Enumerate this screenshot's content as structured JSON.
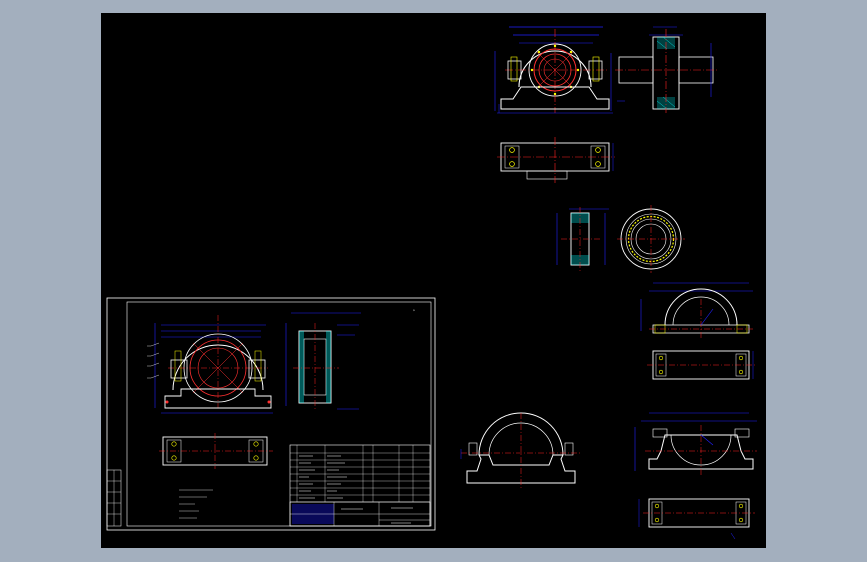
{
  "app": {
    "window_title": "",
    "background_color": "#a3afbe"
  },
  "viewport": {
    "background": "#000000"
  },
  "colors": {
    "outline": "#ffffff",
    "dimension": "#2222ff",
    "centerline": "#ff2222",
    "bearing": "#ff3030",
    "hatch": "#00ffff",
    "fastener": "#ffff00",
    "frame": "#ffffff"
  },
  "sheet": {
    "title_block": {
      "part_rows": [
        "",
        "",
        "",
        "",
        "",
        "",
        "",
        "",
        "",
        ""
      ],
      "name_cell": "",
      "scale_cell": ""
    },
    "notes": [
      "",
      "",
      "",
      ""
    ]
  },
  "views": [
    "front-view-assembly",
    "side-section-assembly",
    "top-view-assembly",
    "bearing-section",
    "bearing-front",
    "cap-front",
    "cap-top",
    "base-front",
    "base-top",
    "housing-side-view"
  ]
}
